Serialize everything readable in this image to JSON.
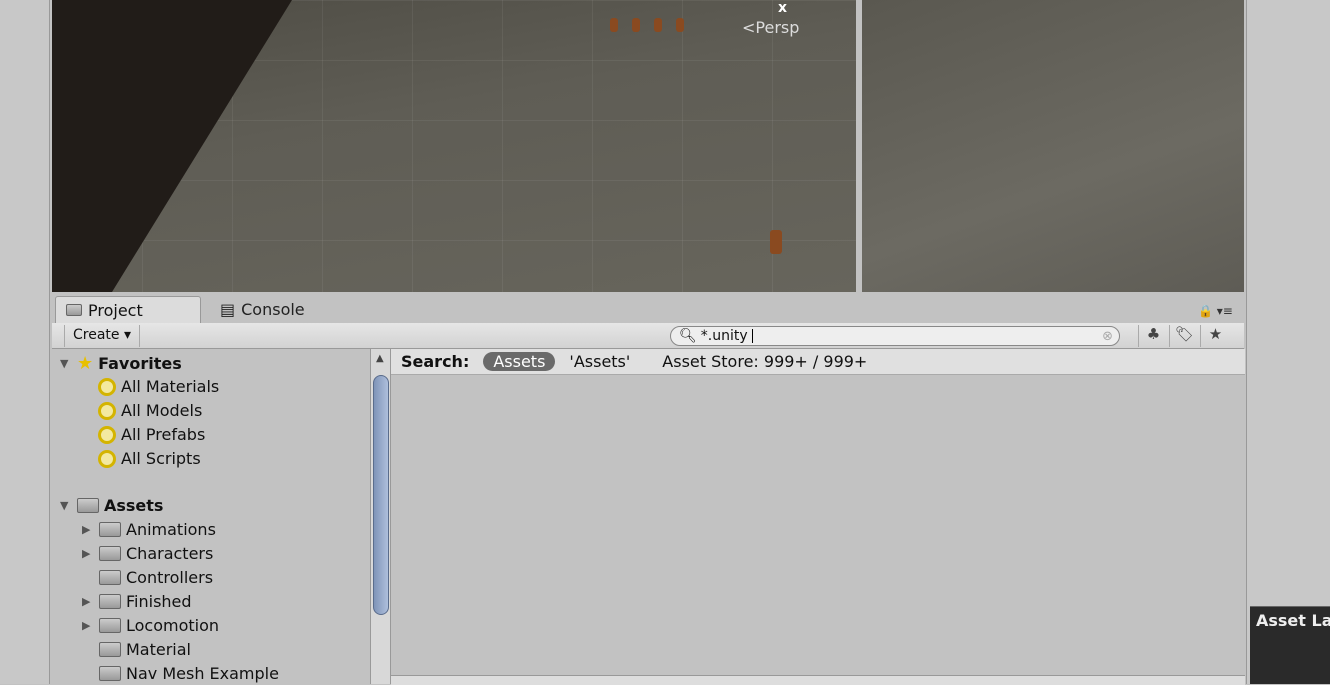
{
  "scene": {
    "persp_label": "Persp",
    "axis_label": "x"
  },
  "tabs": {
    "project": "Project",
    "console": "Console"
  },
  "toolbar": {
    "create": "Create",
    "search_value": "*.unity"
  },
  "tree": {
    "favorites": {
      "label": "Favorites",
      "items": [
        "All Materials",
        "All Models",
        "All Prefabs",
        "All Scripts"
      ]
    },
    "assets": {
      "label": "Assets",
      "items": [
        {
          "label": "Animations",
          "expandable": true
        },
        {
          "label": "Characters",
          "expandable": true
        },
        {
          "label": "Controllers",
          "expandable": false
        },
        {
          "label": "Finished",
          "expandable": true
        },
        {
          "label": "Locomotion",
          "expandable": true
        },
        {
          "label": "Material",
          "expandable": false
        },
        {
          "label": "Nav Mesh Example",
          "expandable": false
        }
      ]
    }
  },
  "search_scope": {
    "label": "Search:",
    "assets": "Assets",
    "quoted_assets": "'Assets'",
    "asset_store": "Asset Store: 999+ / 999+"
  },
  "side_panel": {
    "title": "Asset La"
  }
}
